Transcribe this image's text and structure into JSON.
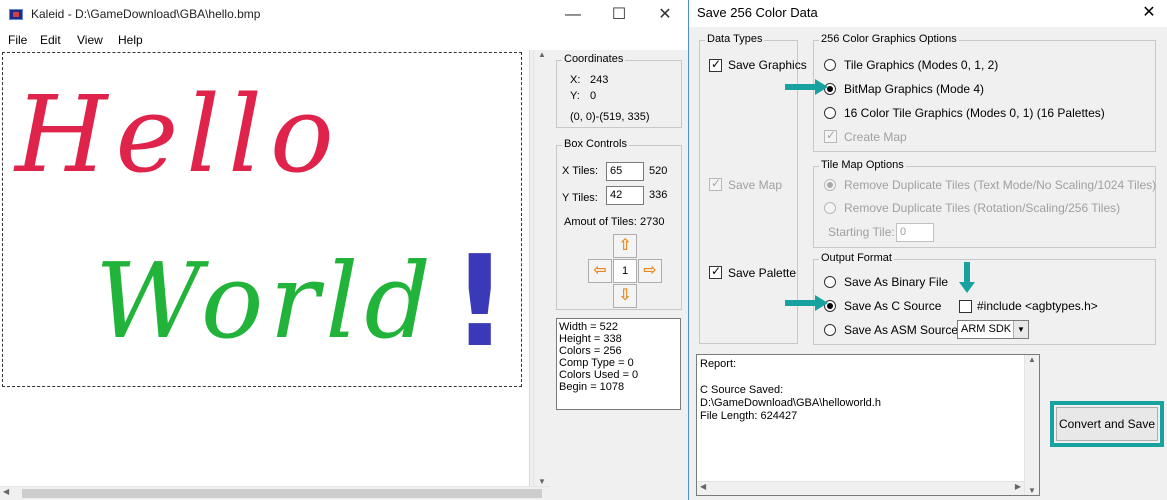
{
  "kaleid": {
    "title": "Kaleid - D:\\GameDownload\\GBA\\hello.bmp",
    "menu": [
      "File",
      "Edit",
      "View",
      "Help"
    ],
    "canvas_text": {
      "line1": "Hello",
      "line2": "World",
      "exclaim": "!"
    },
    "colors": {
      "hello": "#e0234a",
      "world": "#22b33a",
      "exclaim": "#3a3ab8"
    },
    "coordinates": {
      "title": "Coordinates",
      "x_label": "X:",
      "x_value": "243",
      "y_label": "Y:",
      "y_value": "0",
      "range": "(0, 0)-(519, 335)"
    },
    "box_controls": {
      "title": "Box Controls",
      "x_tiles_label": "X Tiles:",
      "x_tiles_value": "65",
      "x_pixels": "520",
      "y_tiles_label": "Y Tiles:",
      "y_tiles_value": "42",
      "y_pixels": "336",
      "amount_label": "Amout of Tiles:",
      "amount_value": "2730",
      "center": "1"
    },
    "info": [
      "Width = 522",
      "Height = 338",
      "Colors = 256",
      "Comp Type = 0",
      "Colors Used = 0",
      "Begin = 1078"
    ]
  },
  "dialog": {
    "title": "Save 256 Color Data",
    "data_types": {
      "title": "Data Types",
      "save_graphics": "Save Graphics",
      "save_map": "Save Map",
      "save_palette": "Save Palette"
    },
    "graphics_options": {
      "title": "256 Color Graphics Options",
      "tile": "Tile Graphics (Modes 0, 1, 2)",
      "bitmap": "BitMap Graphics (Mode 4)",
      "tile16": "16 Color Tile Graphics (Modes 0, 1) (16 Palettes)",
      "create_map": "Create Map"
    },
    "tile_map_options": {
      "title": "Tile Map Options",
      "remove_text": "Remove Duplicate Tiles (Text Mode/No Scaling/1024 Tiles)",
      "remove_rot": "Remove Duplicate Tiles (Rotation/Scaling/256 Tiles)",
      "starting_tile_label": "Starting Tile:",
      "starting_tile_value": "0"
    },
    "output_format": {
      "title": "Output Format",
      "binary": "Save As Binary File",
      "c_source": "Save As C Source",
      "asm_source": "Save As ASM Source",
      "include": "#include <agbtypes.h>",
      "asm_select": "ARM SDK"
    },
    "report": "Report:\n\nC Source Saved:\nD:\\GameDownload\\GBA\\helloworld.h\nFile Length: 624427",
    "convert_button": "Convert and Save",
    "accent": "#17a2a0"
  }
}
